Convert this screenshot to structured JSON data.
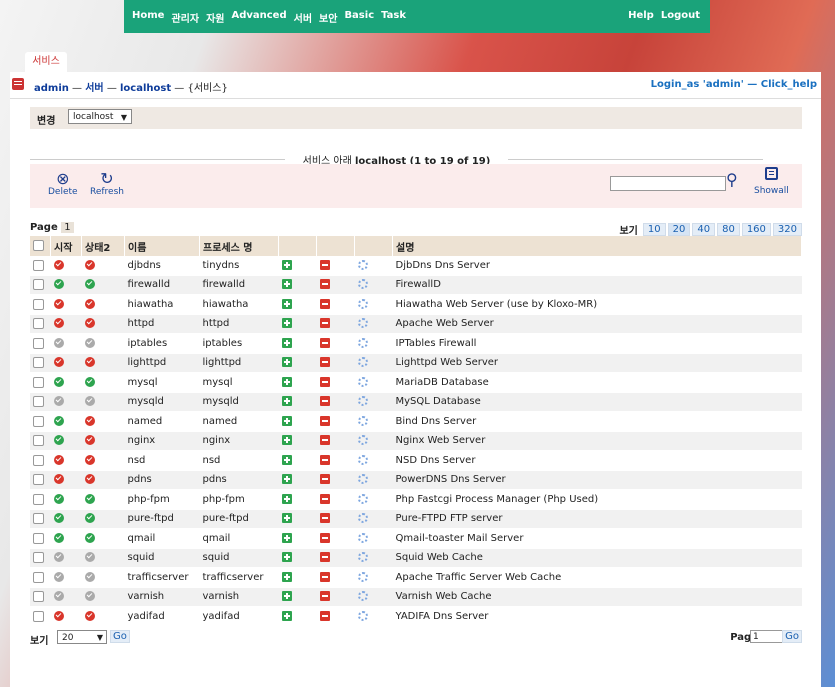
{
  "topnav": {
    "left": [
      "Home",
      "관리자",
      "자원",
      "Advanced",
      "서버",
      "보안",
      "Basic",
      "Task"
    ],
    "right": [
      "Help",
      "Logout"
    ]
  },
  "page_tab": "서비스",
  "breadcrumb": {
    "admin": "admin",
    "sep1": " — ",
    "server": "서버",
    "sep2": " — ",
    "host": "localhost",
    "sep3": " — {서비스}",
    "login_as": "Login_as 'admin'",
    "help_sep": " — ",
    "click_help": "Click_help"
  },
  "change": {
    "label": "변경",
    "selected": "localhost"
  },
  "section_title": {
    "prefix": "서비스 아래 ",
    "bold": "localhost (1 to 19 of 19)"
  },
  "toolbar": {
    "delete": "Delete",
    "refresh": "Refresh",
    "showall": "Showall"
  },
  "pager": {
    "label": "Page",
    "page": "1",
    "sizes_label": "보기",
    "sizes": [
      "10",
      "20",
      "40",
      "80",
      "160",
      "320"
    ],
    "selected_size": "20"
  },
  "columns": [
    "시작",
    "상태2",
    "이름",
    "프로세스 명",
    "",
    "",
    "",
    "설명"
  ],
  "rows": [
    {
      "start": "off",
      "status": "off",
      "name": "djbdns",
      "process": "tinydns",
      "desc": "DjbDns Dns Server"
    },
    {
      "start": "on",
      "status": "on",
      "name": "firewalld",
      "process": "firewalld",
      "desc": "FirewallD"
    },
    {
      "start": "off",
      "status": "off",
      "name": "hiawatha",
      "process": "hiawatha",
      "desc": "Hiawatha Web Server (use by Kloxo-MR)"
    },
    {
      "start": "off",
      "status": "off",
      "name": "httpd",
      "process": "httpd",
      "desc": "Apache Web Server"
    },
    {
      "start": "na",
      "status": "na",
      "name": "iptables",
      "process": "iptables",
      "desc": "IPTables Firewall"
    },
    {
      "start": "off",
      "status": "off",
      "name": "lighttpd",
      "process": "lighttpd",
      "desc": "Lighttpd Web Server"
    },
    {
      "start": "on",
      "status": "on",
      "name": "mysql",
      "process": "mysql",
      "desc": "MariaDB Database"
    },
    {
      "start": "na",
      "status": "na",
      "name": "mysqld",
      "process": "mysqld",
      "desc": "MySQL Database"
    },
    {
      "start": "on",
      "status": "off",
      "name": "named",
      "process": "named",
      "desc": "Bind Dns Server"
    },
    {
      "start": "on",
      "status": "off",
      "name": "nginx",
      "process": "nginx",
      "desc": "Nginx Web Server"
    },
    {
      "start": "off",
      "status": "off",
      "name": "nsd",
      "process": "nsd",
      "desc": "NSD Dns Server"
    },
    {
      "start": "off",
      "status": "off",
      "name": "pdns",
      "process": "pdns",
      "desc": "PowerDNS Dns Server"
    },
    {
      "start": "on",
      "status": "on",
      "name": "php-fpm",
      "process": "php-fpm",
      "desc": "Php Fastcgi Process Manager (Php Used)"
    },
    {
      "start": "on",
      "status": "on",
      "name": "pure-ftpd",
      "process": "pure-ftpd",
      "desc": "Pure-FTPD FTP server"
    },
    {
      "start": "on",
      "status": "on",
      "name": "qmail",
      "process": "qmail",
      "desc": "Qmail-toaster Mail Server"
    },
    {
      "start": "na",
      "status": "na",
      "name": "squid",
      "process": "squid",
      "desc": "Squid Web Cache"
    },
    {
      "start": "na",
      "status": "na",
      "name": "trafficserver",
      "process": "trafficserver",
      "desc": "Apache Traffic Server Web Cache"
    },
    {
      "start": "na",
      "status": "na",
      "name": "varnish",
      "process": "varnish",
      "desc": "Varnish Web Cache"
    },
    {
      "start": "off",
      "status": "off",
      "name": "yadifad",
      "process": "yadifad",
      "desc": "YADIFA Dns Server"
    }
  ],
  "bottom": {
    "label": "보기",
    "selected": "20",
    "go": "Go",
    "page_label": "Page",
    "page_value": "1"
  },
  "colors": {
    "nav": "#1aa37a",
    "on": "#2ea44f",
    "off": "#d9362b",
    "na": "#aaaaaa",
    "header": "#ede2d3"
  }
}
